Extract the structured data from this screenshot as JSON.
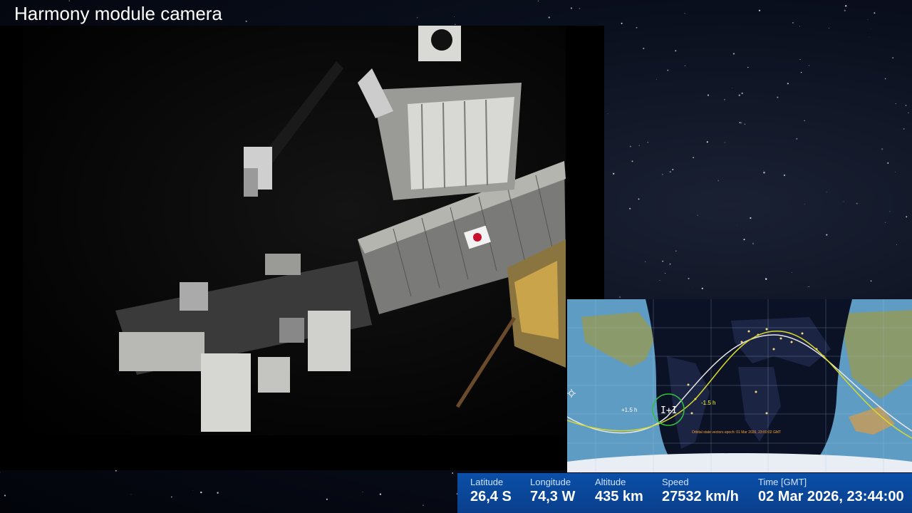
{
  "title": "Harmony module camera",
  "map": {
    "orbit_note": "Orbital state vectors epoch: 01 Mar 2026, 23:00:02 GMT",
    "past_label": "+1.5 h",
    "future_label": "-1.5 h",
    "sun_icon": "sun-icon"
  },
  "telemetry": {
    "latitude_label": "Latitude",
    "latitude_value": "26,4 S",
    "longitude_label": "Longitude",
    "longitude_value": "74,3 W",
    "altitude_label": "Altitude",
    "altitude_value": "435 km",
    "speed_label": "Speed",
    "speed_value": "27532 km/h",
    "time_label": "Time [GMT]",
    "time_value": "02 Mar 2026, 23:44:00"
  },
  "colors": {
    "telemetry_bg": "#0a4fa8",
    "ground_track_current": "#e6e6e6",
    "ground_track_next": "#d8d82a",
    "night": "#0b1226"
  }
}
